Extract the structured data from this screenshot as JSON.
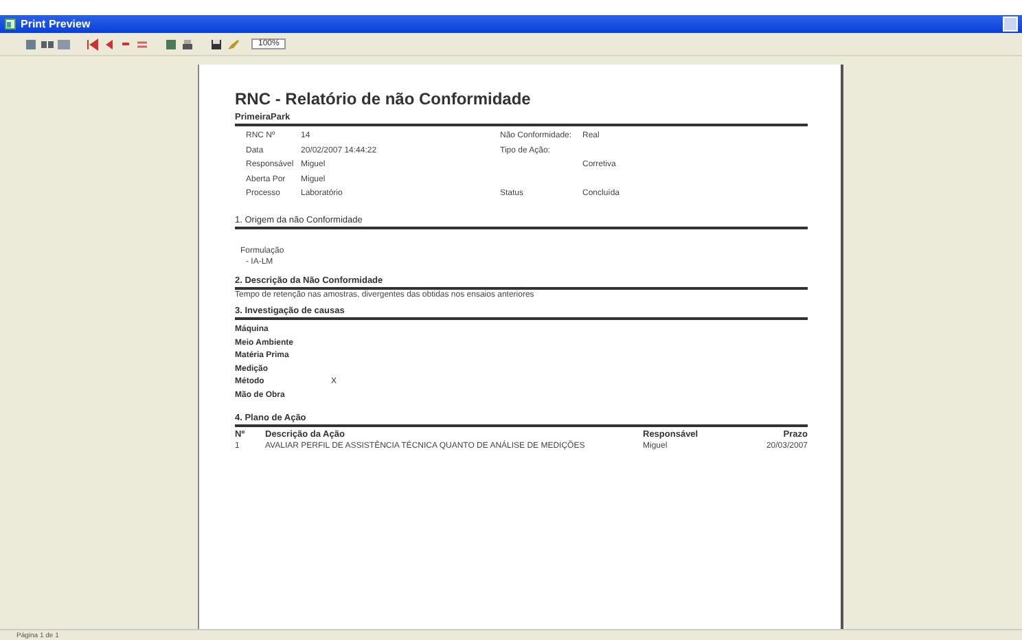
{
  "window": {
    "title": "Print Preview"
  },
  "toolbar": {
    "zoom": "100%"
  },
  "report": {
    "title": "RNC - Relatório de não Conformidade",
    "company": "PrimeiraPark",
    "rows": [
      {
        "label": "RNC Nº",
        "value": "14",
        "right_label": "Não Conformidade:",
        "right_value": "Real"
      },
      {
        "label": "Data",
        "value": "20/02/2007 14:44:22",
        "right_label": "Tipo de Ação:"
      },
      {
        "label": "Responsável",
        "value": "Miguel",
        "right_value": "Corretiva"
      },
      {
        "label": "Aberta Por",
        "value": "Miguel"
      },
      {
        "label": "Processo",
        "value": "Laboratório",
        "right_label": "Status",
        "right_value": "Concluída"
      }
    ],
    "origin": {
      "heading": "1. Origem da não Conformidade",
      "lines": [
        "Formulação",
        "- IA-LM"
      ]
    },
    "description": {
      "heading": "2. Descrição da Não Conformidade",
      "text": "Tempo de retenção nas amostras, divergentes das obtidas nos ensaios anteriores"
    },
    "investigation": {
      "heading": "3. Investigação de causas",
      "causes": [
        {
          "label": "Máquina"
        },
        {
          "label": "Meio Ambiente"
        },
        {
          "label": "Matéria Prima"
        },
        {
          "label": "Medição"
        },
        {
          "label": "Método",
          "mark": "X"
        },
        {
          "label": "Mão de Obra"
        }
      ]
    },
    "action_plan": {
      "heading": "4. Plano de Ação",
      "columns": [
        "Nº",
        "Descrição da Ação",
        "Responsável",
        "Prazo"
      ],
      "rows": [
        [
          "1",
          "AVALIAR PERFIL DE ASSISTÊNCIA TÉCNICA QUANTO DE ANÁLISE DE MEDIÇÕES",
          "Miguel",
          "20/03/2007"
        ]
      ]
    }
  },
  "status_bar": {
    "text": "Página 1 de 1"
  }
}
